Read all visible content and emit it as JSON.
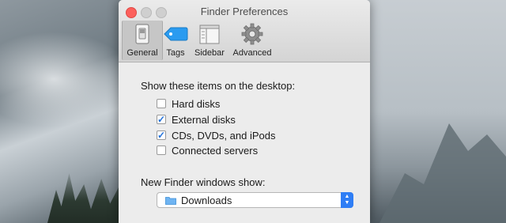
{
  "window": {
    "title": "Finder Preferences"
  },
  "tabs": [
    {
      "label": "General",
      "icon": "general-switch-icon",
      "selected": true
    },
    {
      "label": "Tags",
      "icon": "tag-icon",
      "selected": false
    },
    {
      "label": "Sidebar",
      "icon": "sidebar-icon",
      "selected": false
    },
    {
      "label": "Advanced",
      "icon": "gear-icon",
      "selected": false
    }
  ],
  "desktop_section": {
    "label": "Show these items on the desktop:",
    "items": [
      {
        "label": "Hard disks",
        "checked": false
      },
      {
        "label": "External disks",
        "checked": true
      },
      {
        "label": "CDs, DVDs, and iPods",
        "checked": true
      },
      {
        "label": "Connected servers",
        "checked": false
      }
    ]
  },
  "new_window": {
    "label": "New Finder windows show:",
    "value": "Downloads"
  },
  "colors": {
    "accent": "#2f7ef5",
    "close": "#fc605c",
    "tag": "#2a9bf0"
  }
}
